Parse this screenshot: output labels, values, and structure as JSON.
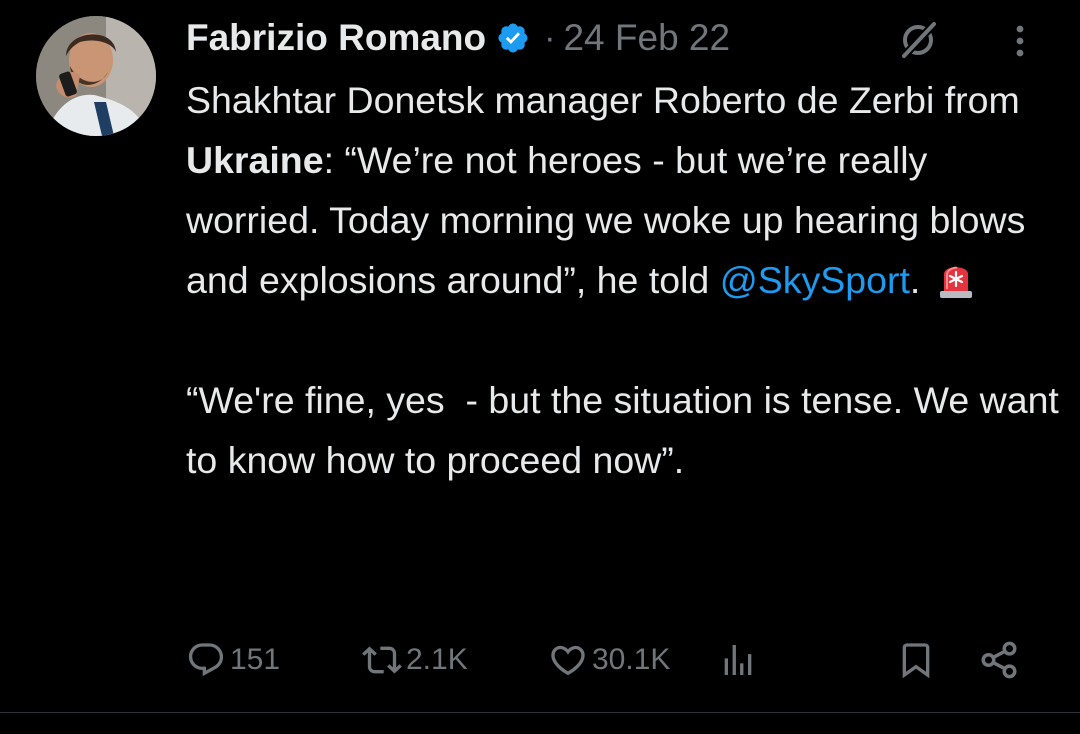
{
  "tweet": {
    "author": {
      "display_name": "Fabrizio Romano",
      "verified_color": "#1d9bf0"
    },
    "separator": "·",
    "date": "24 Feb 22",
    "text": {
      "p1_a": "Shakhtar Donetsk manager Roberto de Zerbi from ",
      "p1_bold": "Ukraine",
      "p1_b": ": “We’re not heroes - but we’re really worried. Today morning we woke up hearing blows and explosions around”, he told ",
      "p1_mention": "@SkySport",
      "p1_c": ". ",
      "p2": "“We're fine, yes  - but the situation is tense. We want to know how to proceed now”."
    },
    "icons": {
      "header": [
        "grok-icon",
        "more-icon"
      ],
      "inline": "siren-icon"
    },
    "actions": {
      "replies": "151",
      "reposts": "2.1K",
      "likes": "30.1K",
      "views": "",
      "icons": [
        "reply-icon",
        "repost-icon",
        "like-icon",
        "views-icon",
        "bookmark-icon",
        "share-icon"
      ]
    },
    "colors": {
      "background": "#000000",
      "text": "#e7e9ea",
      "secondary": "#71767b",
      "link": "#1d9bf0"
    }
  }
}
